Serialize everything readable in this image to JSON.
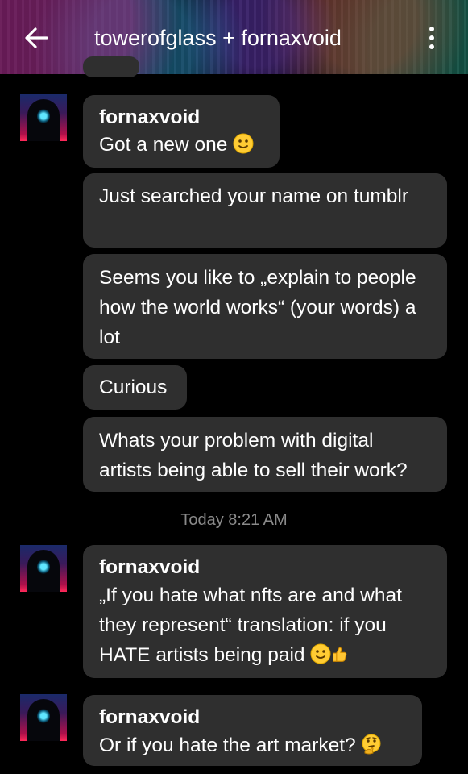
{
  "header": {
    "title": "towerofglass + fornaxvoid",
    "back_icon": "arrow-left-icon",
    "menu_icon": "more-vertical-icon"
  },
  "messages": [
    {
      "sender": "fornaxvoid",
      "text": "Got a new one",
      "emoji": "slightly-smiling-face"
    },
    {
      "text": "Just searched your name on tumblr"
    },
    {
      "text": "Seems you like to „explain to people how the world works“ (your words) a lot"
    },
    {
      "text": "Curious"
    },
    {
      "text": "Whats your problem with digital artists being able to sell their work?"
    }
  ],
  "timestamp": "Today 8:21 AM",
  "messages_after": [
    {
      "sender": "fornaxvoid",
      "text": "„If you hate what nfts are and what they represent“ translation: if you HATE artists being paid",
      "emoji": [
        "slightly-smiling-face",
        "thumbs-up"
      ]
    },
    {
      "sender": "fornaxvoid",
      "text": "Or if you hate the art market?",
      "emoji": "thinking-face"
    }
  ],
  "colors": {
    "background": "#000000",
    "bubble": "#2f2f2f",
    "timestamp": "#8a8a8a"
  }
}
